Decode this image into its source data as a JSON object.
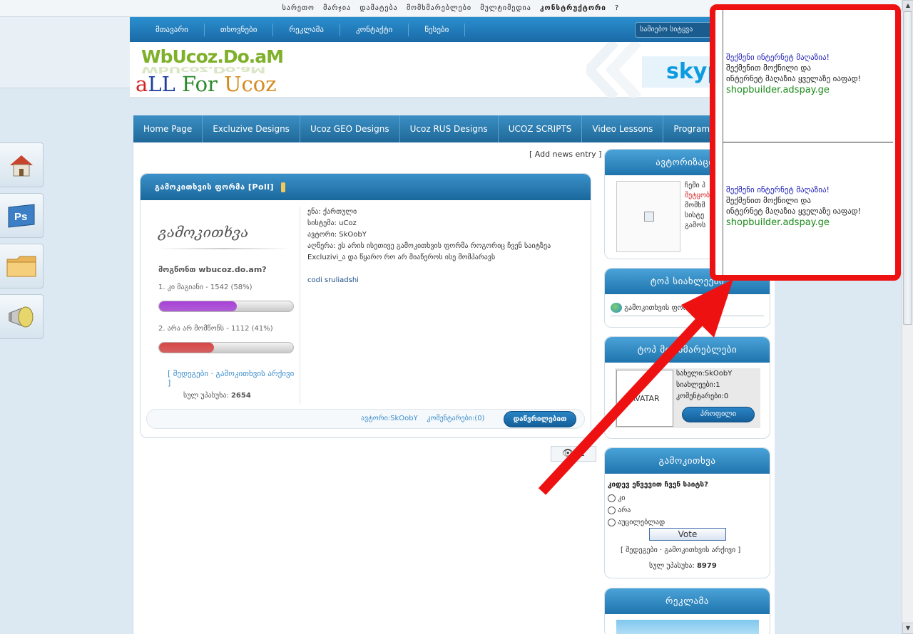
{
  "topbar": {
    "links": [
      "სარეთო",
      "მარჯია",
      "დამატება",
      "მომხმარებლები",
      "მულტიმედია",
      "კონსტრუქტორი",
      "?"
    ]
  },
  "topnav": {
    "items": [
      "მთავარი",
      "თხოვნები",
      "რეკლამა",
      "კონტაქტი",
      "წესები"
    ],
    "search_label": "სამიებო სიტყვა"
  },
  "header": {
    "logo_top": "WbUcoz.Do.aM",
    "logo_bottom": [
      "a",
      "LL",
      " For ",
      "Ucoz"
    ],
    "skype": "skype"
  },
  "mainnav": {
    "items": [
      "Home Page",
      "Excluzive Designs",
      "Ucoz GEO Designs",
      "Ucoz RUS Designs",
      "UCOZ SCRIPTS",
      "Video Lessons",
      "Programs"
    ]
  },
  "content": {
    "add_news": "[ Add news entry ]",
    "post": {
      "title": "გამოკითხვის ფორმა [Poll]",
      "poll": {
        "title": "გამოკითხვა",
        "question": "მოგწონთ wbucoz.do.am?",
        "options": [
          {
            "label": "1. კი მაგიანი - 1542 (58%)",
            "percent": 58,
            "color": "#a640d6"
          },
          {
            "label": "2. არა არ მომწონს - 1112 (41%)",
            "percent": 41,
            "color": "#d64545"
          }
        ],
        "archive": "[ შედეგები · გამოკითხვის არქივი ]",
        "total_label": "სულ უპასუხა:",
        "total": "2654"
      },
      "info_lines": [
        "ენა: ქართული",
        "სისტემა: uCoz",
        "ავტორი: SkOobY",
        "აღწერა: ეს არის ისეთივე გამოკითხვის ფორმა როგორიც ჩვენ საიტზეა",
        " Excluzivi_ა და  წყარო რო არ მიაწეროს ისე მომპარავს"
      ],
      "info_link": "codi sruliadshi",
      "footer": {
        "author": "ავტორი:SkOobY",
        "comments": "კომენტარები:(0)",
        "more_button": "დაწვრილებით"
      }
    }
  },
  "sidebar": {
    "auth": {
      "title": "ავტორიზაცია",
      "lines": [
        "ჩემი პ",
        "შეტყობ",
        "მომხმ",
        "სისტე",
        "გამოს"
      ]
    },
    "top_news": {
      "title": "ტოპ სიახლეები",
      "item": "გამოკითხვის ფორმა [Poll]"
    },
    "top_users": {
      "title": "ტოპ მომხმარებლები",
      "avatar_text": "AVATAR",
      "name": "სახელი:SkOobY",
      "news": "სიახლეები:1",
      "comments": "კომენტარები:0",
      "profile_button": "პროფილი"
    },
    "poll": {
      "title": "გამოკითხვა",
      "question": "კიდევ ეწვევით ჩვენ საიტს?",
      "options": [
        "კი",
        "არა",
        "აუცილებლად"
      ],
      "vote_button": "Vote",
      "archive": "[ შედეგები · გამოკითხვის არქივი ]",
      "total_label": "სულ უპასუხა:",
      "total": "8979"
    },
    "ads": {
      "title": "რეკლამა"
    }
  },
  "ad_popup": {
    "cells": [
      {
        "line1": "შექმენი ინტერნეტ მაღაზია!",
        "line2": "შექმენით მოქნილი და",
        "line3": "ინტერნეტ მაღაზია ყველაზე იაფად!",
        "url": "shopbuilder.adspay.ge"
      },
      {
        "line1": "შექმენი ინტერნეტ მაღაზია!",
        "line2": "შექმენით მოქნილი და",
        "line3": "ინტერნეტ მაღაზია ყველაზე იაფად!",
        "url": "shopbuilder.adspay.ge"
      }
    ]
  },
  "colors": {
    "ad_border": "#ee1111",
    "nav_blue": "#1f6898",
    "link_blue": "#3a8ccc"
  }
}
